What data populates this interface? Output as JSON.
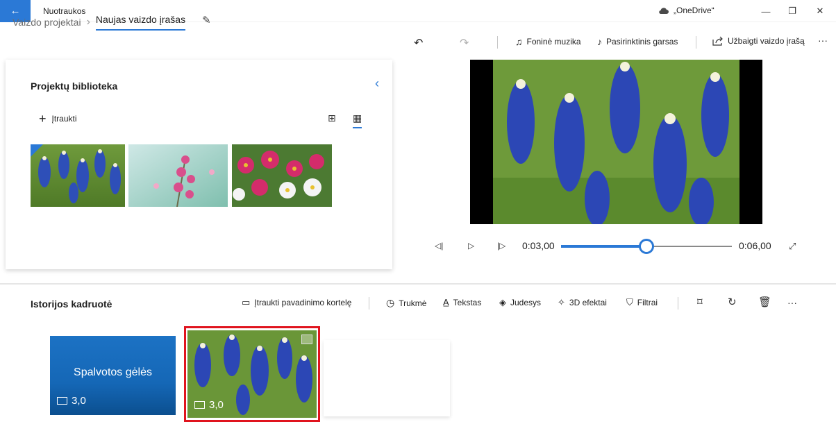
{
  "titlebar": {
    "app_title": "Nuotraukos",
    "onedrive_label": "„OneDrive“",
    "back_icon": "arrow-left-icon",
    "minimize_glyph": "—",
    "restore_glyph": "❐",
    "close_glyph": "✕"
  },
  "breadcrumb": {
    "previous": "Vaizdo projektai",
    "current": "Naujas vaizdo įrašas"
  },
  "toolbar": {
    "background_music": "Foninė muzika",
    "custom_audio": "Pasirinktinis garsas",
    "finish_video": "Užbaigti vaizdo įrašą",
    "more": "···"
  },
  "library": {
    "title": "Projektų biblioteka",
    "add_label": "Įtraukti",
    "add_glyph": "+"
  },
  "playback": {
    "current_time": "0:03,00",
    "total_time": "0:06,00",
    "progress": 0.5
  },
  "storyboard": {
    "title": "Istorijos kadruotė",
    "add_title_card": "Įtraukti pavadinimo kortelę",
    "duration": "Trukmė",
    "text": "Tekstas",
    "motion": "Judesys",
    "effects_3d": "3D efektai",
    "filters": "Filtrai",
    "more": "···",
    "cards": [
      {
        "label": "Spalvotos gėlės",
        "duration": "3,0"
      },
      {
        "duration": "3,0"
      }
    ]
  },
  "colors": {
    "accent": "#2b79d6",
    "title_card": "#1567b6",
    "selection": "#e0141e"
  }
}
